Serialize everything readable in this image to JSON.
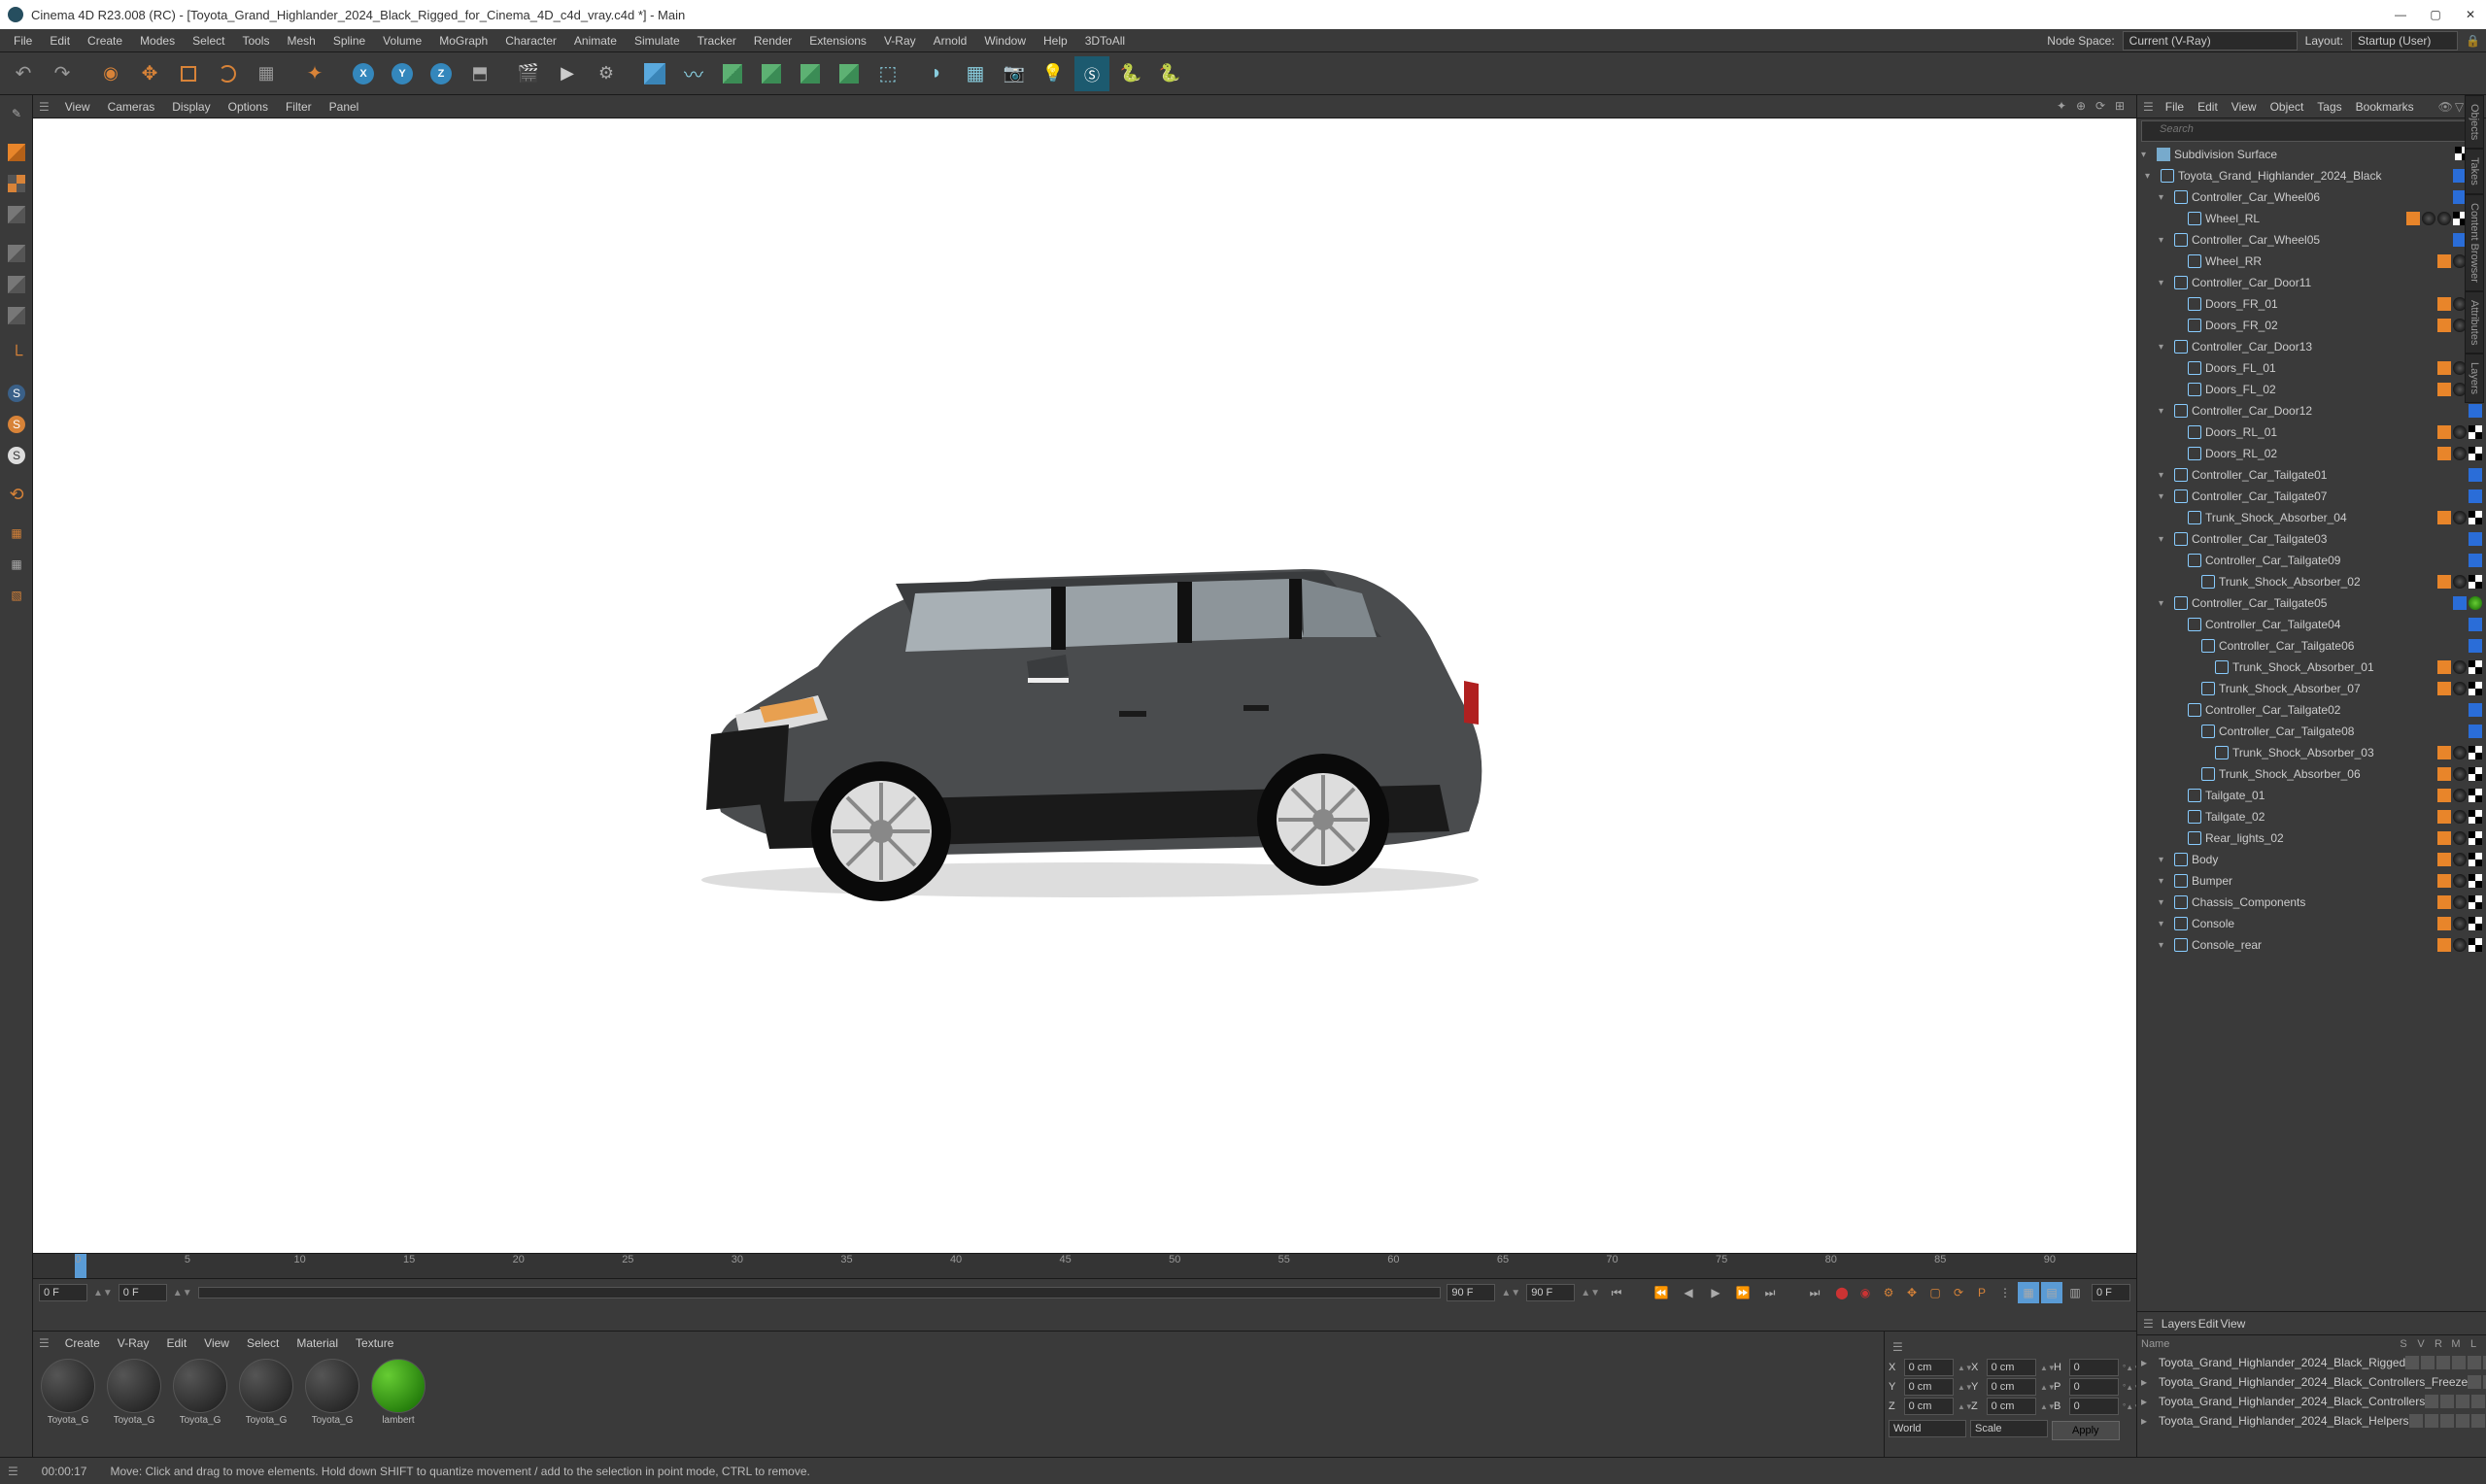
{
  "window": {
    "title": "Cinema 4D R23.008 (RC) - [Toyota_Grand_Highlander_2024_Black_Rigged_for_Cinema_4D_c4d_vray.c4d *] - Main"
  },
  "menu": {
    "items": [
      "File",
      "Edit",
      "Create",
      "Modes",
      "Select",
      "Tools",
      "Mesh",
      "Spline",
      "Volume",
      "MoGraph",
      "Character",
      "Animate",
      "Simulate",
      "Tracker",
      "Render",
      "Extensions",
      "V-Ray",
      "Arnold",
      "Window",
      "Help",
      "3DToAll"
    ],
    "node_space_label": "Node Space:",
    "node_space_value": "Current (V-Ray)",
    "layout_label": "Layout:",
    "layout_value": "Startup (User)"
  },
  "viewport_menu": {
    "items": [
      "View",
      "Cameras",
      "Display",
      "Options",
      "Filter",
      "Panel"
    ]
  },
  "timeline": {
    "ticks": [
      "0",
      "5",
      "10",
      "15",
      "20",
      "25",
      "30",
      "35",
      "40",
      "45",
      "50",
      "55",
      "60",
      "65",
      "70",
      "75",
      "80",
      "85",
      "90"
    ],
    "start_frame": "0 F",
    "start_frame2": "0 F",
    "current_frame": "90 F",
    "end_frame": "90 F",
    "end_label": "0 F"
  },
  "material_menu": {
    "items": [
      "Create",
      "V-Ray",
      "Edit",
      "View",
      "Select",
      "Material",
      "Texture"
    ]
  },
  "materials": [
    {
      "name": "Toyota_G",
      "type": "dark"
    },
    {
      "name": "Toyota_G",
      "type": "dark"
    },
    {
      "name": "Toyota_G",
      "type": "dark"
    },
    {
      "name": "Toyota_G",
      "type": "dark"
    },
    {
      "name": "Toyota_G",
      "type": "dark"
    },
    {
      "name": "lambert",
      "type": "green"
    }
  ],
  "coords": {
    "x1": "0 cm",
    "x2": "0 cm",
    "h": "0",
    "y1": "0 cm",
    "y2": "0 cm",
    "p": "0",
    "z1": "0 cm",
    "z2": "0 cm",
    "b": "0",
    "mode1": "World",
    "mode2": "Scale",
    "apply": "Apply"
  },
  "object_menu": {
    "items": [
      "File",
      "Edit",
      "View",
      "Object",
      "Tags",
      "Bookmarks"
    ]
  },
  "search_placeholder": "Search",
  "hierarchy_root": "Subdivision Surface",
  "hierarchy": [
    {
      "indent": 0,
      "name": "Toyota_Grand_Highlander_2024_Black",
      "tags": [
        "blue",
        "green"
      ]
    },
    {
      "indent": 1,
      "name": "Controller_Car_Wheel06",
      "tags": [
        "blue",
        "green"
      ]
    },
    {
      "indent": 2,
      "name": "Wheel_RL",
      "tags": [
        "orange",
        "dark",
        "dark",
        "checker",
        "checker"
      ]
    },
    {
      "indent": 1,
      "name": "Controller_Car_Wheel05",
      "tags": [
        "blue",
        "green"
      ]
    },
    {
      "indent": 2,
      "name": "Wheel_RR",
      "tags": [
        "orange",
        "dark",
        "checker"
      ]
    },
    {
      "indent": 1,
      "name": "Controller_Car_Door11",
      "tags": [
        "blue"
      ]
    },
    {
      "indent": 2,
      "name": "Doors_FR_01",
      "tags": [
        "orange",
        "dark",
        "checker"
      ]
    },
    {
      "indent": 2,
      "name": "Doors_FR_02",
      "tags": [
        "orange",
        "dark",
        "checker"
      ]
    },
    {
      "indent": 1,
      "name": "Controller_Car_Door13",
      "tags": [
        "blue"
      ]
    },
    {
      "indent": 2,
      "name": "Doors_FL_01",
      "tags": [
        "orange",
        "dark",
        "checker"
      ]
    },
    {
      "indent": 2,
      "name": "Doors_FL_02",
      "tags": [
        "orange",
        "dark",
        "checker"
      ]
    },
    {
      "indent": 1,
      "name": "Controller_Car_Door12",
      "tags": [
        "blue"
      ]
    },
    {
      "indent": 2,
      "name": "Doors_RL_01",
      "tags": [
        "orange",
        "dark",
        "checker"
      ]
    },
    {
      "indent": 2,
      "name": "Doors_RL_02",
      "tags": [
        "orange",
        "dark",
        "checker"
      ]
    },
    {
      "indent": 1,
      "name": "Controller_Car_Tailgate01",
      "tags": [
        "blue"
      ]
    },
    {
      "indent": 1,
      "name": "Controller_Car_Tailgate07",
      "tags": [
        "blue"
      ]
    },
    {
      "indent": 2,
      "name": "Trunk_Shock_Absorber_04",
      "tags": [
        "orange",
        "dark",
        "checker"
      ]
    },
    {
      "indent": 1,
      "name": "Controller_Car_Tailgate03",
      "tags": [
        "blue"
      ]
    },
    {
      "indent": 2,
      "name": "Controller_Car_Tailgate09",
      "tags": [
        "blue"
      ]
    },
    {
      "indent": 3,
      "name": "Trunk_Shock_Absorber_02",
      "tags": [
        "orange",
        "dark",
        "checker"
      ]
    },
    {
      "indent": 1,
      "name": "Controller_Car_Tailgate05",
      "tags": [
        "blue",
        "green"
      ]
    },
    {
      "indent": 2,
      "name": "Controller_Car_Tailgate04",
      "tags": [
        "blue"
      ]
    },
    {
      "indent": 3,
      "name": "Controller_Car_Tailgate06",
      "tags": [
        "blue"
      ]
    },
    {
      "indent": 4,
      "name": "Trunk_Shock_Absorber_01",
      "tags": [
        "orange",
        "dark",
        "checker"
      ]
    },
    {
      "indent": 3,
      "name": "Trunk_Shock_Absorber_07",
      "tags": [
        "orange",
        "dark",
        "checker"
      ]
    },
    {
      "indent": 2,
      "name": "Controller_Car_Tailgate02",
      "tags": [
        "blue"
      ]
    },
    {
      "indent": 3,
      "name": "Controller_Car_Tailgate08",
      "tags": [
        "blue"
      ]
    },
    {
      "indent": 4,
      "name": "Trunk_Shock_Absorber_03",
      "tags": [
        "orange",
        "dark",
        "checker"
      ]
    },
    {
      "indent": 3,
      "name": "Trunk_Shock_Absorber_06",
      "tags": [
        "orange",
        "dark",
        "checker"
      ]
    },
    {
      "indent": 2,
      "name": "Tailgate_01",
      "tags": [
        "orange",
        "dark",
        "checker"
      ]
    },
    {
      "indent": 2,
      "name": "Tailgate_02",
      "tags": [
        "orange",
        "dark",
        "checker"
      ]
    },
    {
      "indent": 2,
      "name": "Rear_lights_02",
      "tags": [
        "orange",
        "dark",
        "checker"
      ]
    },
    {
      "indent": 1,
      "name": "Body",
      "tags": [
        "orange",
        "dark",
        "checker"
      ]
    },
    {
      "indent": 1,
      "name": "Bumper",
      "tags": [
        "orange",
        "dark",
        "checker"
      ]
    },
    {
      "indent": 1,
      "name": "Chassis_Components",
      "tags": [
        "orange",
        "dark",
        "checker"
      ]
    },
    {
      "indent": 1,
      "name": "Console",
      "tags": [
        "orange",
        "dark",
        "checker"
      ]
    },
    {
      "indent": 1,
      "name": "Console_rear",
      "tags": [
        "orange",
        "dark",
        "checker"
      ]
    }
  ],
  "layers_menu": {
    "items": [
      "Layers",
      "Edit",
      "View"
    ]
  },
  "layers_cols": [
    "S",
    "V",
    "R",
    "M",
    "L"
  ],
  "layers_name_col": "Name",
  "layers": [
    {
      "color": "#e8852a",
      "name": "Toyota_Grand_Highlander_2024_Black_Rigged"
    },
    {
      "color": "#a458c0",
      "name": "Toyota_Grand_Highlander_2024_Black_Controllers_Freeze"
    },
    {
      "color": "#2a6dd8",
      "name": "Toyota_Grand_Highlander_2024_Black_Controllers"
    },
    {
      "color": "#2a6dd8",
      "name": "Toyota_Grand_Highlander_2024_Black_Helpers"
    }
  ],
  "right_tabs": [
    "Objects",
    "Takes",
    "Content Browser",
    "Attributes",
    "Layers"
  ],
  "status": {
    "time": "00:00:17",
    "hint": "Move: Click and drag to move elements. Hold down SHIFT to quantize movement / add to the selection in point mode, CTRL to remove."
  },
  "axes": {
    "x": "X",
    "y": "Y",
    "z": "Z",
    "h": "H",
    "p": "P",
    "b": "B"
  }
}
